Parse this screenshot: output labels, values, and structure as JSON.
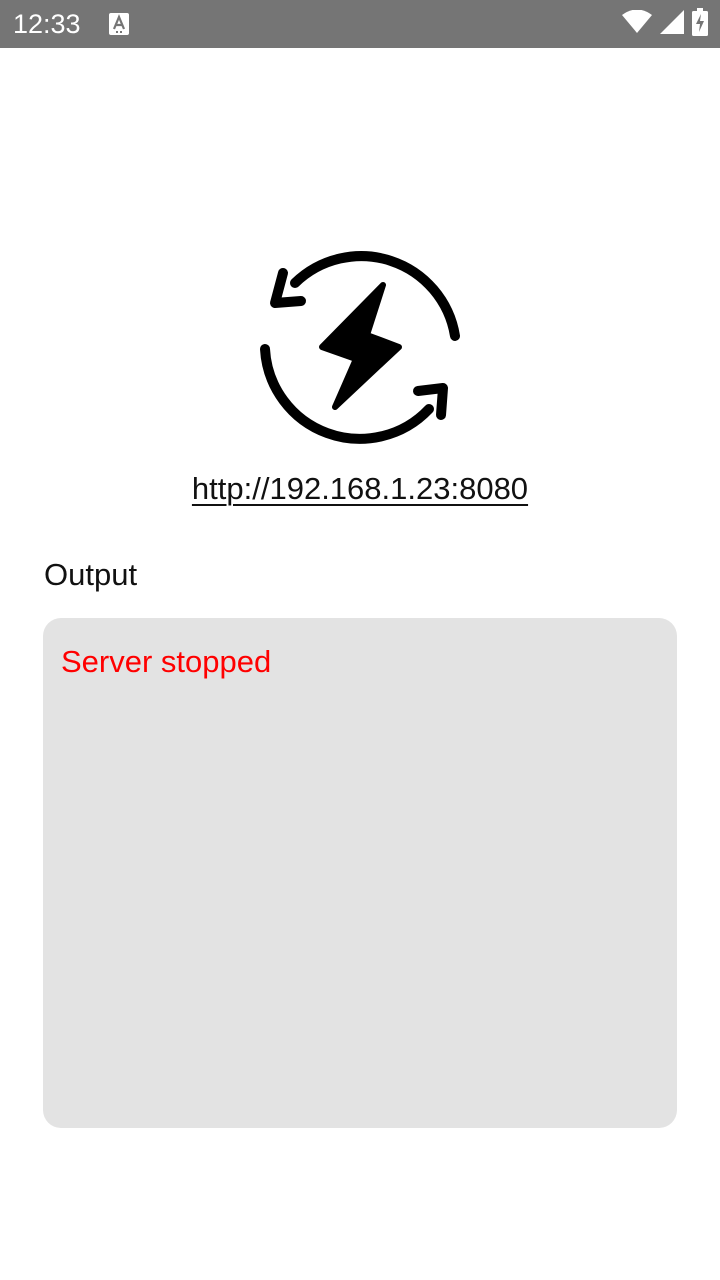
{
  "status_bar": {
    "time": "12:33",
    "notification_icon": "text-notification-icon",
    "icons": [
      "wifi-icon",
      "cellular-signal-icon",
      "battery-charging-icon"
    ]
  },
  "app": {
    "logo_icon": "sync-lightning-icon",
    "server_url": "http://192.168.1.23:8080",
    "output_label": "Output",
    "output_text": "Server stopped",
    "output_text_color": "#ff0000",
    "output_background": "#e3e3e3"
  }
}
